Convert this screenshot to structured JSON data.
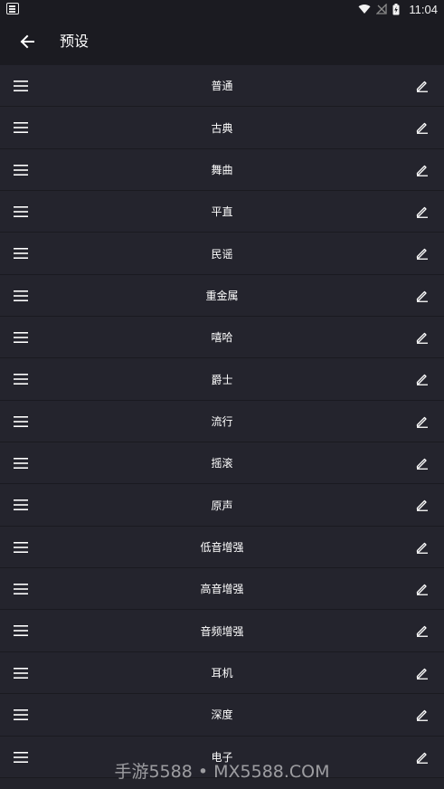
{
  "status_bar": {
    "time": "11:04",
    "icons": [
      "app-notification-icon",
      "wifi-icon",
      "no-signal-icon",
      "battery-charging-icon"
    ]
  },
  "app_bar": {
    "title": "预设",
    "back_icon": "arrow-left-icon"
  },
  "presets": [
    {
      "label": "普通"
    },
    {
      "label": "古典"
    },
    {
      "label": "舞曲"
    },
    {
      "label": "平直"
    },
    {
      "label": "民谣"
    },
    {
      "label": "重金属"
    },
    {
      "label": "嘻哈"
    },
    {
      "label": "爵士"
    },
    {
      "label": "流行"
    },
    {
      "label": "摇滚"
    },
    {
      "label": "原声"
    },
    {
      "label": "低音增强"
    },
    {
      "label": "高音增强"
    },
    {
      "label": "音频增强"
    },
    {
      "label": "耳机"
    },
    {
      "label": "深度"
    },
    {
      "label": "电子"
    }
  ],
  "row_icons": {
    "left": "drag-handle-icon",
    "right": "edit-icon"
  },
  "watermark": "手游5588 • MX5588.COM",
  "colors": {
    "background": "#24242d",
    "app_bar": "#1b1b21",
    "text": "#ffffff"
  }
}
